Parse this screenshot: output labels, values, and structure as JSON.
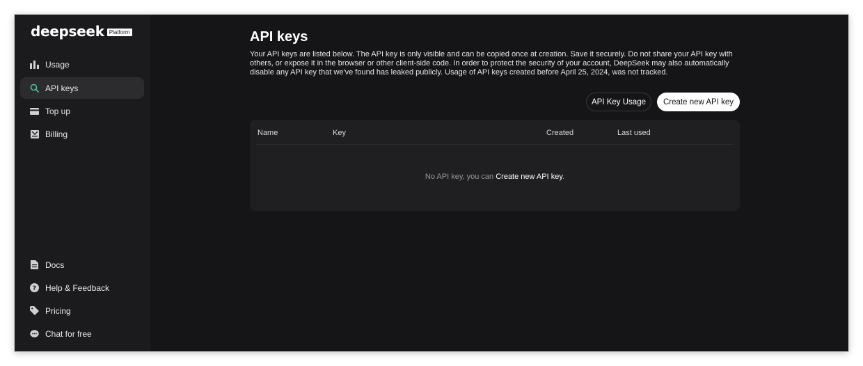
{
  "brand": {
    "name": "deepseek",
    "badge": "Platform"
  },
  "sidebar": {
    "top_items": [
      {
        "label": "Usage",
        "icon": "bar-chart-icon",
        "active": false
      },
      {
        "label": "API keys",
        "icon": "search-icon",
        "active": true
      },
      {
        "label": "Top up",
        "icon": "card-icon",
        "active": false
      },
      {
        "label": "Billing",
        "icon": "billing-icon",
        "active": false
      }
    ],
    "bottom_items": [
      {
        "label": "Docs",
        "icon": "document-icon"
      },
      {
        "label": "Help & Feedback",
        "icon": "help-icon"
      },
      {
        "label": "Pricing",
        "icon": "tag-icon"
      },
      {
        "label": "Chat for free",
        "icon": "chat-icon"
      }
    ]
  },
  "main": {
    "title": "API keys",
    "description": "Your API keys are listed below. The API key is only visible and can be copied once at creation. Save it securely. Do not share your API key with others, or expose it in the browser or other client-side code. In order to protect the security of your account, DeepSeek may also automatically disable any API key that we've found has leaked publicly. Usage of API keys created before April 25, 2024, was not tracked.",
    "buttons": {
      "usage": "API Key Usage",
      "create": "Create new API key"
    },
    "table": {
      "columns": [
        "Name",
        "Key",
        "Created",
        "Last used"
      ],
      "rows": [],
      "empty_prefix": "No API key, you can ",
      "empty_link": "Create new API key",
      "empty_suffix": "."
    }
  },
  "colors": {
    "background": "#151517",
    "sidebar": "#1b1b1d",
    "active_item": "#2c2c2f",
    "accent_green": "#4cc38a",
    "panel": "#1f1f21"
  }
}
